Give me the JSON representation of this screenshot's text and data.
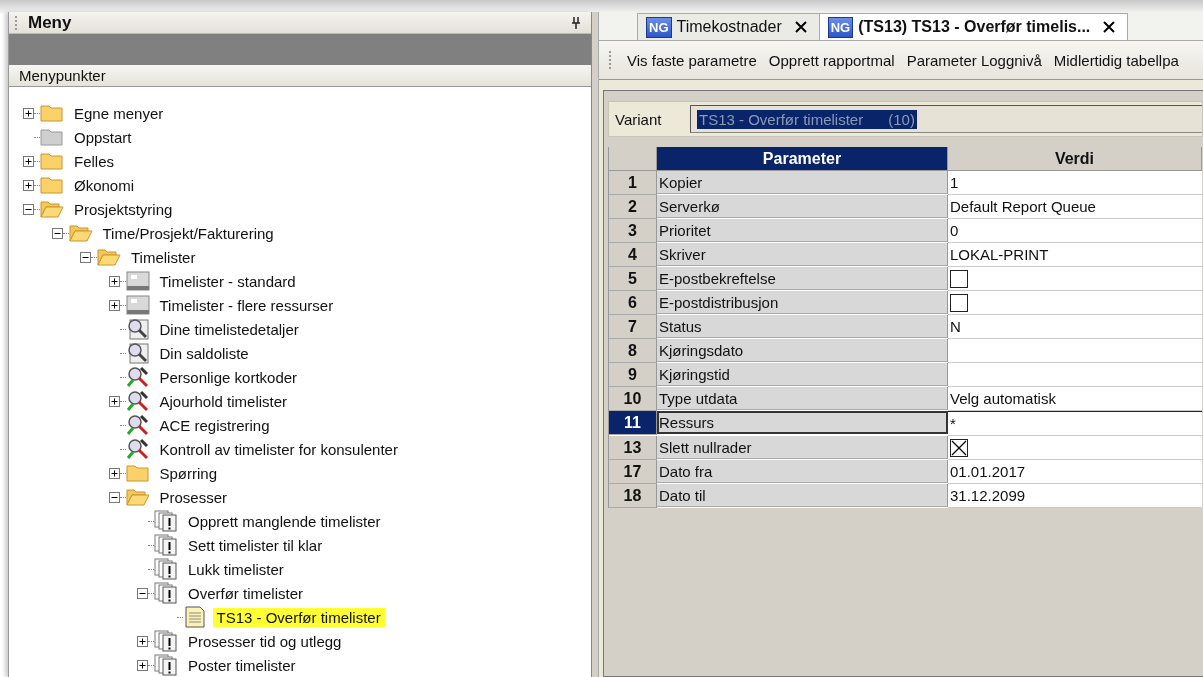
{
  "menu_panel": {
    "title": "Meny",
    "section_title": "Menypunkter",
    "tree": [
      {
        "label": "Egne menyer",
        "kind": "folder",
        "expanded": false,
        "selected": false
      },
      {
        "label": "Oppstart",
        "kind": "grey-folder",
        "selected": false
      },
      {
        "label": "Felles",
        "kind": "folder",
        "expanded": false,
        "selected": false
      },
      {
        "label": "Økonomi",
        "kind": "folder",
        "expanded": false,
        "selected": false
      },
      {
        "label": "Prosjektstyring",
        "kind": "folder",
        "expanded": true,
        "selected": false,
        "children": [
          {
            "label": "Time/Prosjekt/Fakturering",
            "kind": "folder",
            "expanded": true,
            "selected": false,
            "children": [
              {
                "label": "Timelister",
                "kind": "folder",
                "expanded": true,
                "selected": false,
                "children": [
                  {
                    "label": "Timelister - standard",
                    "kind": "report",
                    "expanded": false,
                    "selected": false
                  },
                  {
                    "label": "Timelister - flere ressurser",
                    "kind": "report",
                    "expanded": false,
                    "selected": false
                  },
                  {
                    "label": "Dine timelistedetaljer",
                    "kind": "inspect",
                    "selected": false
                  },
                  {
                    "label": "Din saldoliste",
                    "kind": "inspect",
                    "selected": false
                  },
                  {
                    "label": "Personlige kortkoder",
                    "kind": "tools",
                    "selected": false
                  },
                  {
                    "label": "Ajourhold timelister",
                    "kind": "tools",
                    "expanded": false,
                    "selected": false
                  },
                  {
                    "label": "ACE registrering",
                    "kind": "tools",
                    "selected": false
                  },
                  {
                    "label": "Kontroll av timelister for konsulenter",
                    "kind": "tools",
                    "selected": false
                  },
                  {
                    "label": "Spørring",
                    "kind": "folder",
                    "expanded": false,
                    "selected": false
                  },
                  {
                    "label": "Prosesser",
                    "kind": "folder",
                    "expanded": true,
                    "selected": false,
                    "children": [
                      {
                        "label": "Opprett manglende timelister",
                        "kind": "process",
                        "selected": false
                      },
                      {
                        "label": "Sett timelister til klar",
                        "kind": "process",
                        "selected": false
                      },
                      {
                        "label": "Lukk timelister",
                        "kind": "process",
                        "selected": false
                      },
                      {
                        "label": "Overfør timelister",
                        "kind": "process",
                        "expanded": true,
                        "selected": false,
                        "children": [
                          {
                            "label": "TS13 - Overfør timelister",
                            "kind": "document",
                            "selected": true
                          }
                        ]
                      },
                      {
                        "label": "Prosesser tid og utlegg",
                        "kind": "process",
                        "expanded": false,
                        "selected": false
                      },
                      {
                        "label": "Poster timelister",
                        "kind": "process",
                        "expanded": false,
                        "selected": false
                      }
                    ]
                  }
                ]
              }
            ]
          }
        ]
      }
    ]
  },
  "tabs": [
    {
      "badge": "NG",
      "label": "Timekostnader",
      "selected": false
    },
    {
      "badge": "NG",
      "label": "(TS13) TS13 - Overfør timelis...",
      "selected": true
    }
  ],
  "toolbar": [
    "Vis faste parametre",
    "Opprett rapportmal",
    "Parameter Loggnivå",
    "Midlertidig tabellpa"
  ],
  "variant": {
    "label": "Variant",
    "value": "TS13 - Overfør timelister",
    "count": "(10)"
  },
  "table": {
    "columns": [
      {
        "label": "Parameter",
        "selected": true
      },
      {
        "label": "Verdi",
        "selected": false
      }
    ],
    "rows": [
      {
        "number": "1",
        "parameter": "Kopier",
        "kind": "text",
        "value": "1",
        "selected": false
      },
      {
        "number": "2",
        "parameter": "Serverkø",
        "kind": "text",
        "value": "Default Report Queue",
        "selected": false
      },
      {
        "number": "3",
        "parameter": "Prioritet",
        "kind": "text",
        "value": "0",
        "selected": false
      },
      {
        "number": "4",
        "parameter": "Skriver",
        "kind": "text",
        "value": "LOKAL-PRINT",
        "selected": false
      },
      {
        "number": "5",
        "parameter": "E-postbekreftelse",
        "kind": "checkbox",
        "checked": false,
        "selected": false
      },
      {
        "number": "6",
        "parameter": "E-postdistribusjon",
        "kind": "checkbox",
        "checked": false,
        "selected": false
      },
      {
        "number": "7",
        "parameter": "Status",
        "kind": "text",
        "value": "N",
        "selected": false
      },
      {
        "number": "8",
        "parameter": "Kjøringsdato",
        "kind": "text",
        "selected": false
      },
      {
        "number": "9",
        "parameter": "Kjøringstid",
        "kind": "text",
        "selected": false
      },
      {
        "number": "10",
        "parameter": "Type utdata",
        "kind": "text",
        "value": "Velg automatisk",
        "selected": false
      },
      {
        "number": "11",
        "parameter": "Ressurs",
        "kind": "text",
        "value": "*",
        "selected": true
      },
      {
        "number": "13",
        "parameter": "Slett nullrader",
        "kind": "checkbox",
        "checked": true,
        "selected": false
      },
      {
        "number": "17",
        "parameter": "Dato fra",
        "kind": "text",
        "value": "01.01.2017",
        "selected": false
      },
      {
        "number": "18",
        "parameter": "Dato til",
        "kind": "text",
        "value": "31.12.2099",
        "selected": false
      }
    ]
  }
}
